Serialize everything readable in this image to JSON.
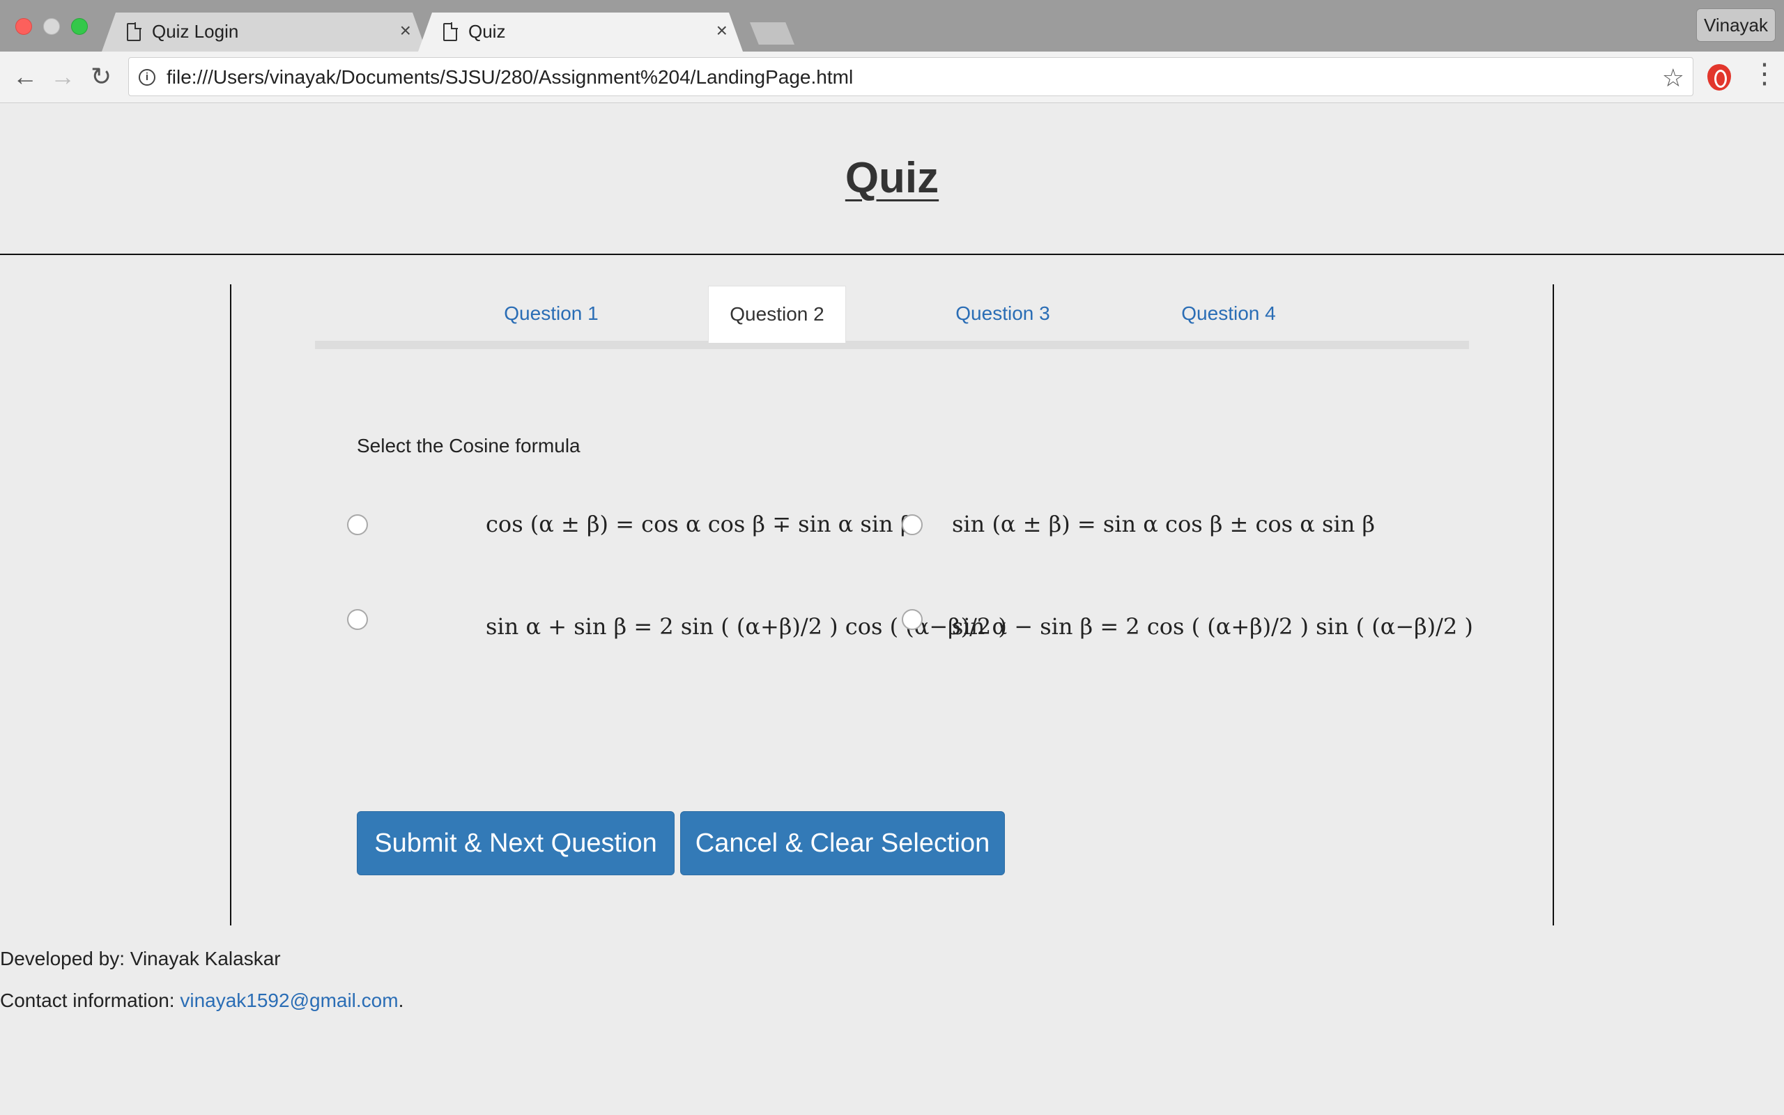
{
  "browser": {
    "tabs": [
      {
        "title": "Quiz Login",
        "close": "×"
      },
      {
        "title": "Quiz",
        "close": "×"
      }
    ],
    "profile_name": "Vinayak",
    "url": "file:///Users/vinayak/Documents/SJSU/280/Assignment%204/LandingPage.html",
    "icons": {
      "back": "←",
      "forward": "→",
      "reload": "↻",
      "info": "i",
      "star": "☆",
      "menu": "⋮"
    }
  },
  "page": {
    "title": "Quiz",
    "tabs": [
      {
        "label": "Question 1"
      },
      {
        "label": "Question 2"
      },
      {
        "label": "Question 3"
      },
      {
        "label": "Question 4"
      }
    ],
    "active_tab": "Question 2",
    "prompt": "Select the Cosine formula",
    "options": [
      "cos (α ± β) = cos α cos β ∓ sin α sin β",
      "sin (α ± β) = sin α cos β ± cos α sin β",
      "sin α + sin β = 2 sin ( (α+β)/2 ) cos ( (α−β)/2 )",
      "sin α − sin β = 2 cos ( (α+β)/2 ) sin ( (α−β)/2 )"
    ],
    "buttons": {
      "submit": "Submit & Next Question",
      "cancel": "Cancel & Clear Selection"
    }
  },
  "footer": {
    "developed_by": "Developed by: Vinayak Kalaskar",
    "contact_label": "Contact information: ",
    "email": "vinayak1592@gmail.com",
    "period": "."
  },
  "colors": {
    "accent": "#337ab7",
    "link": "#2a6db5",
    "page_bg": "#ececec"
  }
}
